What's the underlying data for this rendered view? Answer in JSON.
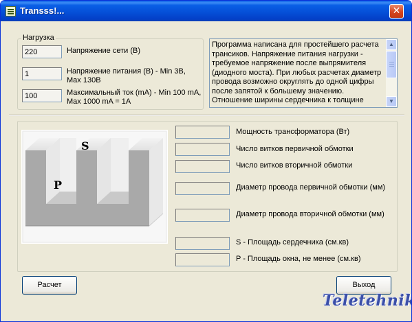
{
  "window": {
    "title": "Transss!...",
    "close_glyph": "✕"
  },
  "load_group": {
    "title": "Нагрузка",
    "rows": [
      {
        "value": "220",
        "label": "Напряжение сети (В)"
      },
      {
        "value": "1",
        "label_line1": "Напряжение питания (В) - Min 3В,",
        "label_line2": "Max 130В"
      },
      {
        "value": "100",
        "label_line1": "Максимальный ток (mA) - Min 100 mA,",
        "label_line2": "Max 1000 mA = 1A"
      }
    ]
  },
  "info_memo": {
    "lines": [
      "Программа написана для простейшего расчета",
      "трансиков. Напряжение питания нагрузки -",
      "требуемое напряжение после выпрямителя",
      "(диодного моста). При любых расчетах диаметр",
      "провода возможно округлять до одной цифры",
      "после запятой к большему значению.",
      "Отношение ширины сердечника к толщине"
    ]
  },
  "diagram": {
    "label_s": "S",
    "label_p": "P"
  },
  "results": [
    {
      "label": "Мощность трансформатора (Вт)",
      "value": ""
    },
    {
      "label": "Число витков первичной обмотки",
      "value": ""
    },
    {
      "label": "Число витков вторичной обмотки",
      "value": ""
    },
    {
      "label": "Диаметр провода первичной обмотки (мм)",
      "value": ""
    },
    {
      "label": "Диаметр провода вторичной обмотки (мм)",
      "value": ""
    },
    {
      "label": "S - Площадь сердечника (см.кв)",
      "value": ""
    },
    {
      "label": "P - Площадь окна, не менее (см.кв)",
      "value": ""
    }
  ],
  "buttons": {
    "calculate": "Расчет",
    "exit": "Выход"
  },
  "watermark": "Teletehnika"
}
